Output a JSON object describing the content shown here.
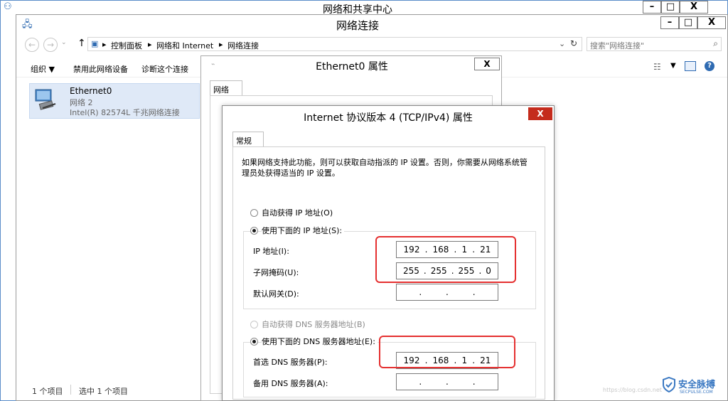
{
  "outer_window": {
    "title": "网络和共享中心"
  },
  "main_window": {
    "title": "网络连接",
    "breadcrumb": [
      "控制面板",
      "网络和 Internet",
      "网络连接"
    ],
    "search_placeholder": "搜索\"网络连接\"",
    "menu": [
      "组织 ▼",
      "禁用此网络设备",
      "诊断这个连接"
    ],
    "adapter": {
      "name": "Ethernet0",
      "network": "网络 2",
      "device": "Intel(R) 82574L 千兆网络连接"
    },
    "status": {
      "count": "1 个项目",
      "selected": "选中 1 个项目"
    }
  },
  "eth_dialog": {
    "title": "Ethernet0 属性",
    "tab": "网络"
  },
  "tcp_dialog": {
    "title": "Internet 协议版本 4 (TCP/IPv4) 属性",
    "tab": "常规",
    "description": "如果网络支持此功能，则可以获取自动指派的 IP 设置。否则，你需要从网络系统管理员处获得适当的 IP 设置。",
    "auto_ip_label": "自动获得 IP 地址(O)",
    "manual_ip_label": "使用下面的 IP 地址(S):",
    "ip_label": "IP 地址(I):",
    "ip": [
      "192",
      "168",
      "1",
      "21"
    ],
    "mask_label": "子网掩码(U):",
    "mask": [
      "255",
      "255",
      "255",
      "0"
    ],
    "gateway_label": "默认网关(D):",
    "gateway": [
      "",
      "",
      "",
      ""
    ],
    "auto_dns_label": "自动获得 DNS 服务器地址(B)",
    "manual_dns_label": "使用下面的 DNS 服务器地址(E):",
    "pref_dns_label": "首选 DNS 服务器(P):",
    "pref_dns": [
      "192",
      "168",
      "1",
      "21"
    ],
    "alt_dns_label": "备用 DNS 服务器(A):",
    "alt_dns": [
      "",
      "",
      "",
      ""
    ]
  },
  "watermark": {
    "logo_text": "安全脉搏",
    "logo_sub": "SECPULSE.COM",
    "url": "https://blog.csdn.net"
  },
  "colors": {
    "highlight_box": "#e53030",
    "close_button": "#c42b1c",
    "selection": "#dfe9f7"
  }
}
